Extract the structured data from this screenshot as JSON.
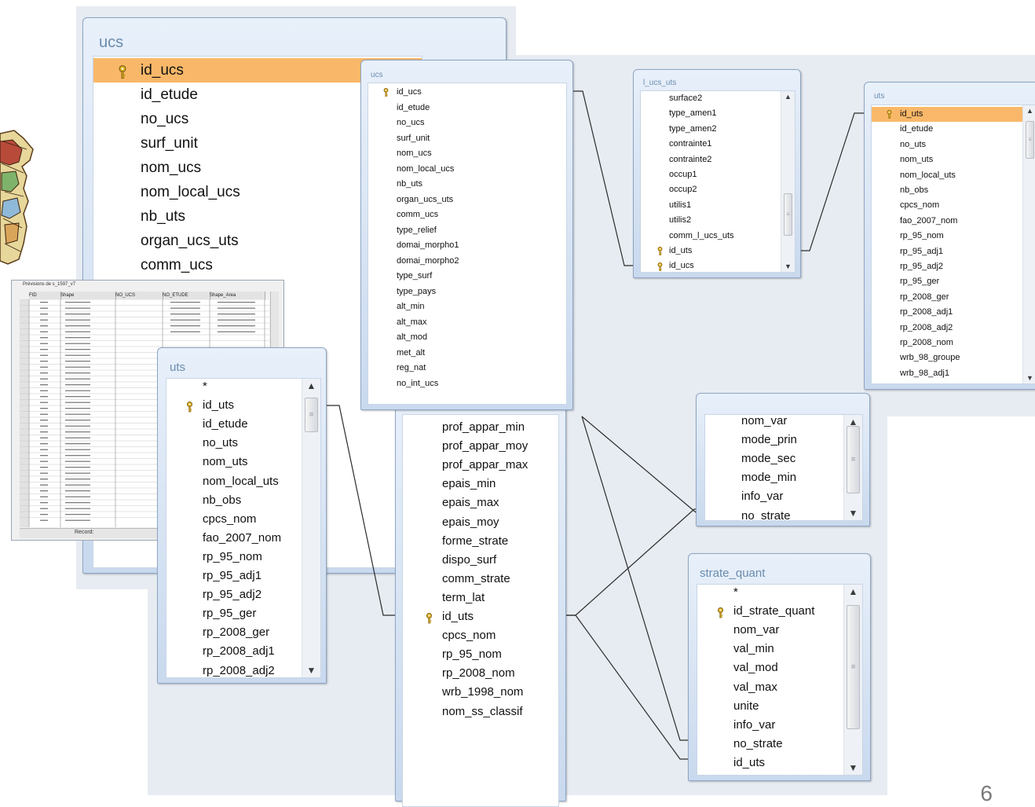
{
  "page_number": "6",
  "ucs_large": {
    "title": "ucs",
    "fields": [
      "id_ucs",
      "id_etude",
      "no_ucs",
      "surf_unit",
      "nom_ucs",
      "nom_local_ucs",
      "nb_uts",
      "organ_ucs_uts",
      "comm_ucs"
    ],
    "key_field": "id_ucs"
  },
  "ucs_small": {
    "title": "ucs",
    "fields": [
      "id_ucs",
      "id_etude",
      "no_ucs",
      "surf_unit",
      "nom_ucs",
      "nom_local_ucs",
      "nb_uts",
      "organ_ucs_uts",
      "comm_ucs",
      "type_relief",
      "domai_morpho1",
      "domai_morpho2",
      "type_surf",
      "type_pays",
      "alt_min",
      "alt_max",
      "alt_mod",
      "met_alt",
      "reg_nat",
      "no_int_ucs"
    ]
  },
  "l_ucs_uts": {
    "title": "l_ucs_uts",
    "fields": [
      "surface2",
      "type_amen1",
      "type_amen2",
      "contrainte1",
      "contrainte2",
      "occup1",
      "occup2",
      "utilis1",
      "utilis2",
      "comm_l_ucs_uts",
      "id_uts",
      "id_ucs"
    ]
  },
  "uts_right": {
    "title": "uts",
    "fields": [
      "id_uts",
      "id_etude",
      "no_uts",
      "nom_uts",
      "nom_local_uts",
      "nb_obs",
      "cpcs_nom",
      "fao_2007_nom",
      "rp_95_nom",
      "rp_95_adj1",
      "rp_95_adj2",
      "rp_95_ger",
      "rp_2008_ger",
      "rp_2008_adj1",
      "rp_2008_adj2",
      "rp_2008_nom",
      "wrb_98_groupe",
      "wrb_98_adj1"
    ]
  },
  "uts_left": {
    "title": "uts",
    "fields": [
      "*",
      "id_uts",
      "id_etude",
      "no_uts",
      "nom_uts",
      "nom_local_uts",
      "nb_obs",
      "cpcs_nom",
      "fao_2007_nom",
      "rp_95_nom",
      "rp_95_adj1",
      "rp_95_adj2",
      "rp_95_ger",
      "rp_2008_ger",
      "rp_2008_adj1",
      "rp_2008_adj2"
    ]
  },
  "strate": {
    "fields": [
      "prof_appar_min",
      "prof_appar_moy",
      "prof_appar_max",
      "epais_min",
      "epais_max",
      "epais_moy",
      "forme_strate",
      "dispo_surf",
      "comm_strate",
      "term_lat",
      "id_uts",
      "cpcs_nom",
      "rp_95_nom",
      "rp_2008_nom",
      "wrb_1998_nom",
      "nom_ss_classif"
    ]
  },
  "strate_qual": {
    "fields": [
      "nom_var",
      "mode_prin",
      "mode_sec",
      "mode_min",
      "info_var",
      "no_strate"
    ]
  },
  "strate_quant": {
    "title": "strate_quant",
    "fields": [
      "*",
      "id_strate_quant",
      "nom_var",
      "val_min",
      "val_mod",
      "val_max",
      "unite",
      "info_var",
      "no_strate",
      "id_uts"
    ]
  },
  "datasheet": {
    "title": "Prévisions de s_1597_v7",
    "headers": [
      "FID",
      "Shape",
      "NO_UCS",
      "NO_ETUDE",
      "Shape_Area"
    ],
    "nav_label": "Record:"
  },
  "icons": {
    "key": "key-icon",
    "scroll_up": "▲",
    "scroll_down": "▼",
    "thumb_grip": "≡"
  },
  "colors": {
    "title_bar": "#c9d9ee",
    "title_text": "#6b8cae",
    "highlight": "#f9b869",
    "canvas": "#e7ecf2",
    "line": "#2b2b2b"
  }
}
